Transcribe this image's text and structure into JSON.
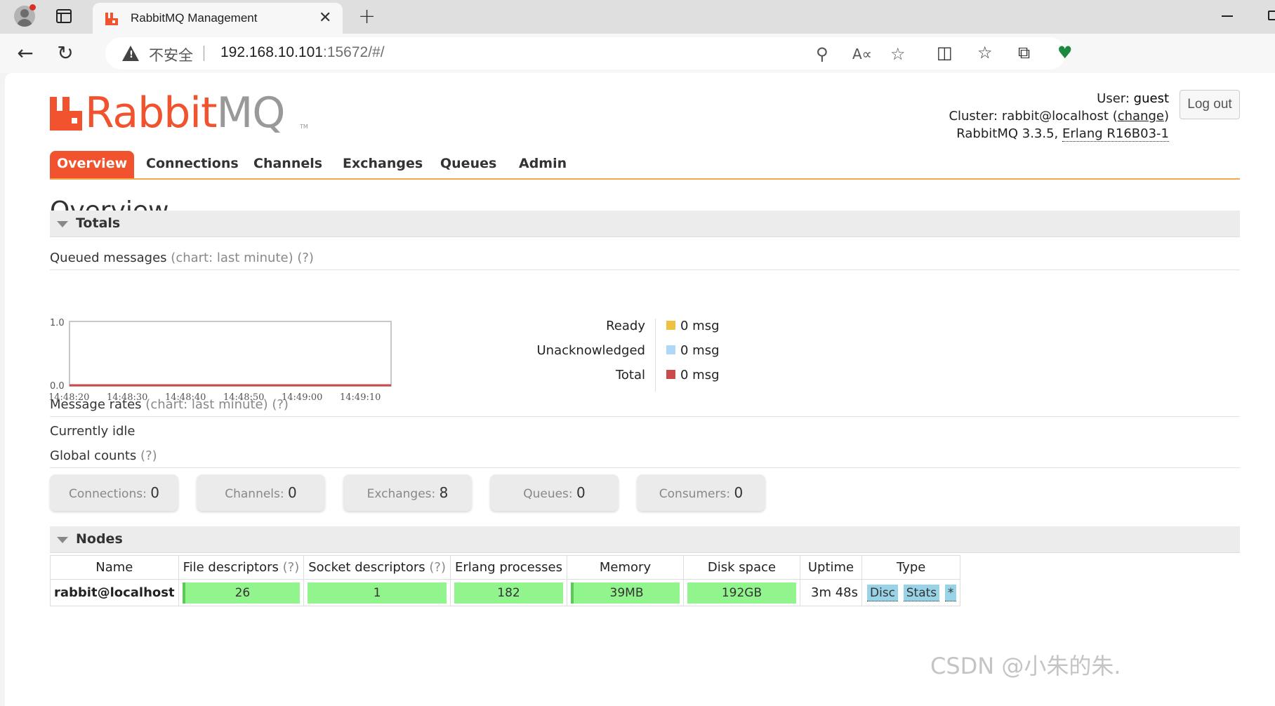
{
  "browser": {
    "tab_title": "RabbitMQ Management",
    "tab_close": "✕",
    "new_tab": "+",
    "insecure_label": "不安全",
    "url_host": "192.168.10.101",
    "url_rest": ":15672/#/"
  },
  "header": {
    "logo_rabbit": "Rabbit",
    "logo_mq": "MQ",
    "logo_tm": "TM",
    "user_label": "User:",
    "user_value": "guest",
    "cluster_label": "Cluster:",
    "cluster_value": "rabbit@localhost",
    "cluster_change": "change",
    "version": "RabbitMQ 3.3.5,",
    "erlang": "Erlang R16B03-1",
    "logout": "Log out"
  },
  "nav": [
    "Overview",
    "Connections",
    "Channels",
    "Exchanges",
    "Queues",
    "Admin"
  ],
  "page_title": "Overview",
  "totals": {
    "title": "Totals",
    "queued_title": "Queued messages",
    "queued_hint": "(chart: last minute) (?)",
    "legend": [
      {
        "label": "Ready",
        "value": "0 msg",
        "color": "#edc240"
      },
      {
        "label": "Unacknowledged",
        "value": "0 msg",
        "color": "#afd8f8"
      },
      {
        "label": "Total",
        "value": "0 msg",
        "color": "#cb4b4b"
      }
    ],
    "rates_title": "Message rates",
    "rates_hint": "(chart: last minute) (?)",
    "idle": "Currently idle",
    "global_title": "Global counts",
    "global_hint": "(?)",
    "counts": [
      {
        "label": "Connections:",
        "value": "0"
      },
      {
        "label": "Channels:",
        "value": "0"
      },
      {
        "label": "Exchanges:",
        "value": "8"
      },
      {
        "label": "Queues:",
        "value": "0"
      },
      {
        "label": "Consumers:",
        "value": "0"
      }
    ]
  },
  "chart_data": {
    "type": "line",
    "x": [
      "14:48:20",
      "14:48:30",
      "14:48:40",
      "14:48:50",
      "14:49:00",
      "14:49:10"
    ],
    "series": [
      {
        "name": "Total",
        "values": [
          0,
          0,
          0,
          0,
          0,
          0
        ]
      }
    ],
    "ylim": [
      0,
      1
    ],
    "yticks": [
      "1.0",
      "0.0"
    ],
    "colors": {
      "line": "#cb4b4b",
      "frame": "#c8c8c8"
    }
  },
  "nodes": {
    "title": "Nodes",
    "headers": [
      "Name",
      "File descriptors",
      "Socket descriptors",
      "Erlang processes",
      "Memory",
      "Disk space",
      "Uptime",
      "Type"
    ],
    "header_hint": "(?)",
    "row": {
      "name": "rabbit@localhost",
      "file_descriptors": "26",
      "socket_descriptors": "1",
      "erlang_processes": "182",
      "memory": "39MB",
      "disk_space": "192GB",
      "uptime": "3m 48s",
      "types": [
        "Disc",
        "Stats",
        "*"
      ]
    }
  },
  "watermark": "CSDN @小朱的朱."
}
